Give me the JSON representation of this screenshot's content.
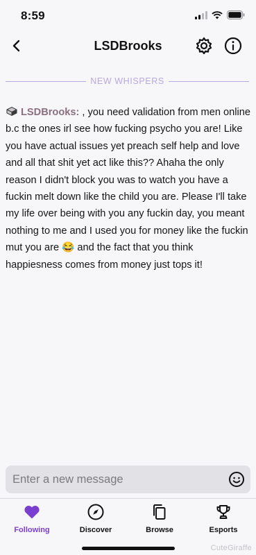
{
  "status_bar": {
    "time": "8:59"
  },
  "header": {
    "title": "LSDBrooks"
  },
  "divider": {
    "label": "NEW WHISPERS"
  },
  "message": {
    "username": "LSDBrooks:",
    "text_part1": " , you need validation from men online b.c the ones irl see how fucking psycho you are! Like you have actual issues yet preach self help and love and all that shit yet act like this?? Ahaha the only reason I didn't block you was to watch you have a fuckin melt down like the child you are. Please I'll take my life over being with you any fuckin day, you meant nothing to me and I used you for money like the fuckin mut you are ",
    "emoji": "😂",
    "text_part2": " and the fact that you think happiesness comes from money just tops it!"
  },
  "composer": {
    "placeholder": "Enter a new message"
  },
  "tabs": [
    {
      "label": "Following",
      "icon": "heart-icon",
      "active": true
    },
    {
      "label": "Discover",
      "icon": "compass-icon",
      "active": false
    },
    {
      "label": "Browse",
      "icon": "browse-icon",
      "active": false
    },
    {
      "label": "Esports",
      "icon": "trophy-icon",
      "active": false
    }
  ],
  "watermark": "CuteGiraffe",
  "colors": {
    "accent": "#7b3fd0",
    "divider": "#b8a8e0",
    "username": "#8a7080"
  }
}
